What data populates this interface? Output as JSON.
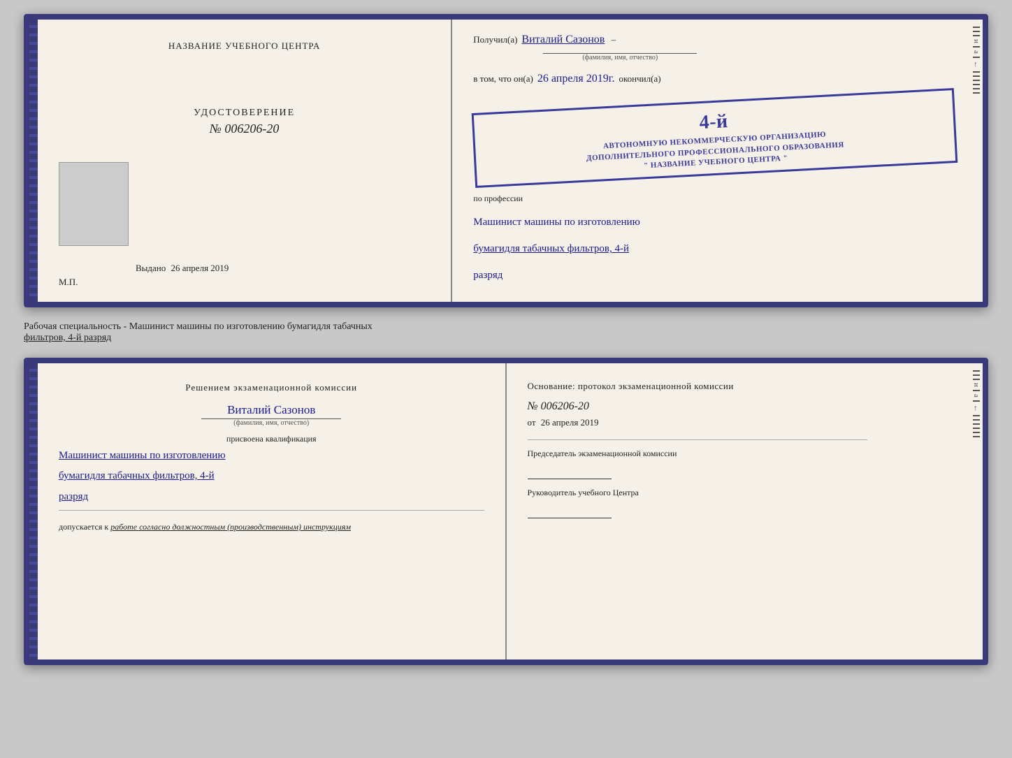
{
  "doc1": {
    "left": {
      "title": "НАЗВАНИЕ УЧЕБНОГО ЦЕНТРА",
      "udostoverenie_label": "УДОСТОВЕРЕНИЕ",
      "number": "№ 006206-20",
      "vydano_prefix": "Выдано",
      "vydano_date": "26 апреля 2019",
      "mp_label": "М.П."
    },
    "right": {
      "poluchil_prefix": "Получил(a)",
      "poluchil_name": "Виталий Сазонов",
      "poluchil_sub": "(фамилия, имя, отчество)",
      "vtom_prefix": "в том, что он(а)",
      "vtom_date": "26 апреля 2019г.",
      "okonchil_suffix": "окончил(а)",
      "stamp_line1": "АВТОНОМНУЮ НЕКОММЕРЧЕСКУЮ ОРГАНИЗАЦИЮ",
      "stamp_line2": "ДОПОЛНИТЕЛЬНОГО ПРОФЕССИОНАЛЬНОГО ОБРАЗОВАНИЯ",
      "stamp_line3": "\" НАЗВАНИЕ УЧЕБНОГО ЦЕНТРА \"",
      "stamp_number": "4-й",
      "po_professii": "по профессии",
      "profession1": "Машинист машины по изготовлению",
      "profession2": "бумагидля табачных фильтров, 4-й",
      "profession3": "разряд"
    }
  },
  "description": {
    "text1": "Рабочая специальность - Машинист машины по изготовлению бумагидля табачных",
    "text2": "фильтров, 4-й разряд"
  },
  "doc2": {
    "left": {
      "komissia_text": "Решением экзаменационной комиссии",
      "name": "Виталий Сазонов",
      "name_sub": "(фамилия, имя, отчество)",
      "prisvoena": "присвоена квалификация",
      "kval1": "Машинист машины по изготовлению",
      "kval2": "бумагидля табачных фильтров, 4-й",
      "kval3": "разряд",
      "dopuskaetsya": "допускается к",
      "dopuskaetsya_italic": "работе согласно должностным (производственным) инструкциям"
    },
    "right": {
      "osnovanie": "Основание: протокол экзаменационной комиссии",
      "number": "№ 006206-20",
      "ot_prefix": "от",
      "ot_date": "26 апреля 2019",
      "chairman_label": "Председатель экзаменационной комиссии",
      "director_label": "Руководитель учебного Центра"
    }
  }
}
